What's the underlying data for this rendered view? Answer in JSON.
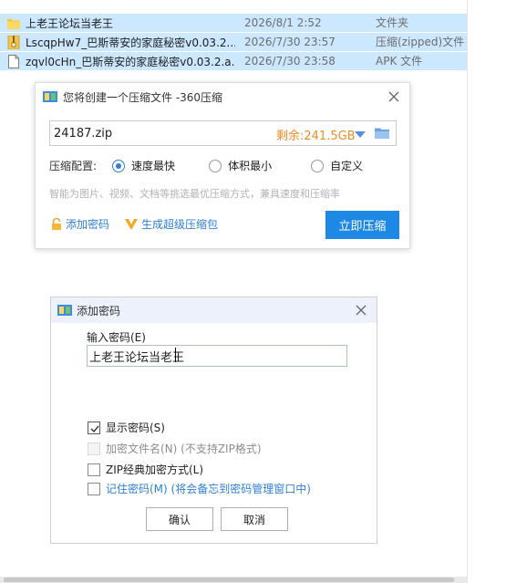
{
  "file_list": {
    "rows": [
      {
        "name": "上老王论坛当老王",
        "date": "2026/8/1 2:52",
        "type": "文件夹",
        "icon": "folder-icon"
      },
      {
        "name": "LscqpHw7_巴斯蒂安的家庭秘密v0.03.2....",
        "date": "2026/7/30 23:57",
        "type": "压缩(zipped)文件",
        "icon": "zip-file-icon"
      },
      {
        "name": "zqvl0cHn_巴斯蒂安的家庭秘密v0.03.2.a...",
        "date": "2026/7/30 23:58",
        "type": "APK 文件",
        "icon": "file-icon"
      }
    ]
  },
  "compress_dialog": {
    "title": "您将创建一个压缩文件 -360压缩",
    "filename": "24187.zip",
    "free_space": "剩余:241.5GB",
    "config_label": "压缩配置:",
    "options": [
      {
        "label": "速度最快",
        "selected": true
      },
      {
        "label": "体积最小",
        "selected": false
      },
      {
        "label": "自定义",
        "selected": false
      }
    ],
    "hint": "智能为图片、视频、文档等挑选最优压缩方式，兼具速度和压缩率",
    "add_password_link": "添加密码",
    "super_zip_link": "生成超级压缩包",
    "compress_button": "立即压缩",
    "accent_color": "#1e88e5",
    "free_space_color": "#f28c28"
  },
  "password_dialog": {
    "title": "添加密码",
    "input_label": "输入密码(E)",
    "password_value": "上老王论坛当老王",
    "show_password": "显示密码(S)",
    "encrypt_filenames": "加密文件名(N) (不支持ZIP格式)",
    "zip_classic": "ZIP经典加密方式(L)",
    "remember_password": "记住密码(M) (将会备忘到密码管理窗口中)",
    "ok_button": "确认",
    "cancel_button": "取消"
  }
}
